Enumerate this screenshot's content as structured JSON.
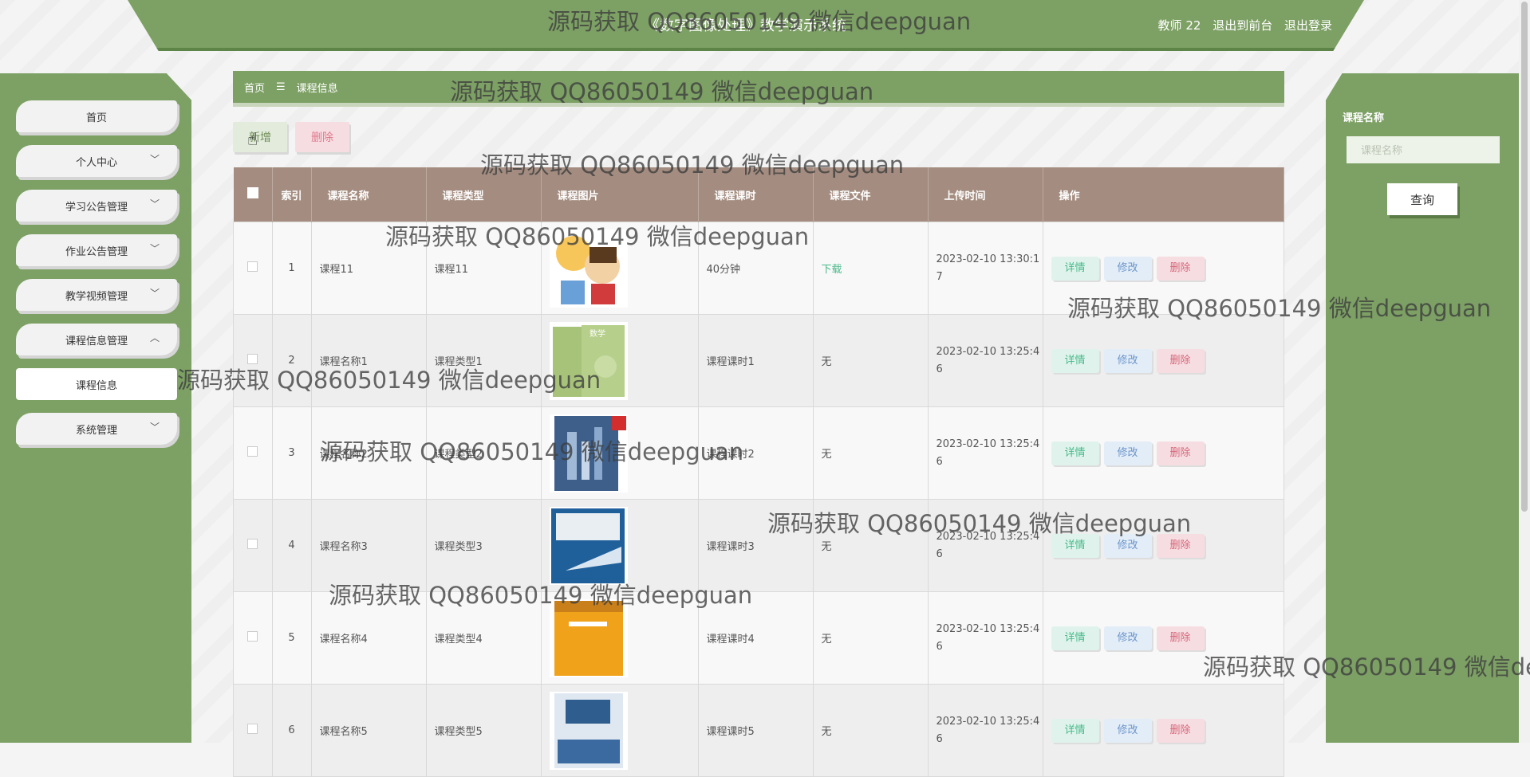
{
  "header": {
    "title": "《数字图像处理》教学演示系统",
    "user": "教师 22",
    "front": "退出到前台",
    "logout": "退出登录"
  },
  "sidebar": {
    "items": [
      {
        "label": "首页",
        "chevron": ""
      },
      {
        "label": "个人中心",
        "chevron": "﹀"
      },
      {
        "label": "学习公告管理",
        "chevron": "﹀"
      },
      {
        "label": "作业公告管理",
        "chevron": "﹀"
      },
      {
        "label": "教学视频管理",
        "chevron": "﹀"
      },
      {
        "label": "课程信息管理",
        "chevron": "︿"
      }
    ],
    "sub_item": "课程信息",
    "last_item": {
      "label": "系统管理",
      "chevron": "﹀"
    }
  },
  "breadcrumb": {
    "home": "首页",
    "sep": "☰",
    "current": "课程信息"
  },
  "toolbar": {
    "add": "新增",
    "delete": "删除"
  },
  "table": {
    "headers": [
      "索引",
      "课程名称",
      "课程类型",
      "课程图片",
      "课程课时",
      "课程文件",
      "上传时间",
      "操作"
    ],
    "rows": [
      {
        "idx": "1",
        "name": "课程11",
        "type": "课程11",
        "hours": "40分钟",
        "file": "下载",
        "time": "2023-02-10 13:30:17"
      },
      {
        "idx": "2",
        "name": "课程名称1",
        "type": "课程类型1",
        "hours": "课程课时1",
        "file": "无",
        "time": "2023-02-10 13:25:46"
      },
      {
        "idx": "3",
        "name": "课程名称2",
        "type": "课程类型2",
        "hours": "课程课时2",
        "file": "无",
        "time": "2023-02-10 13:25:46"
      },
      {
        "idx": "4",
        "name": "课程名称3",
        "type": "课程类型3",
        "hours": "课程课时3",
        "file": "无",
        "time": "2023-02-10 13:25:46"
      },
      {
        "idx": "5",
        "name": "课程名称4",
        "type": "课程类型4",
        "hours": "课程课时4",
        "file": "无",
        "time": "2023-02-10 13:25:46"
      },
      {
        "idx": "6",
        "name": "课程名称5",
        "type": "课程类型5",
        "hours": "课程课时5",
        "file": "无",
        "time": "2023-02-10 13:25:46"
      }
    ],
    "actions": {
      "detail": "详情",
      "edit": "修改",
      "delete": "删除"
    }
  },
  "search": {
    "label": "课程名称",
    "placeholder": "课程名称",
    "button": "查询"
  },
  "watermark": "源码获取 QQ86050149 微信deepguan",
  "colors": {
    "primary": "#7da065",
    "table_header": "#a48d80"
  }
}
